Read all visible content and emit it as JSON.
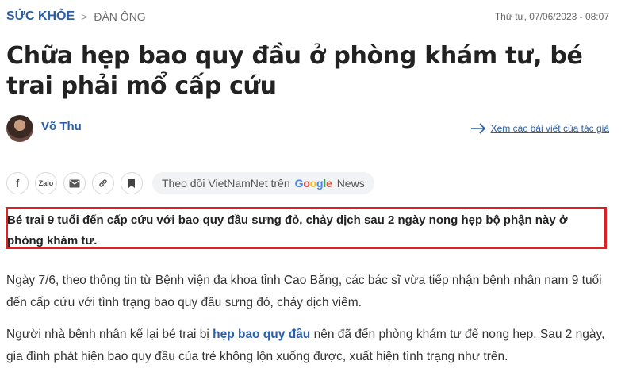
{
  "header": {
    "category": "SỨC KHỎE",
    "breadcrumb_separator": ">",
    "subcategory": "ĐÀN ÔNG",
    "datetime": "Thứ tư, 07/06/2023 - 08:07"
  },
  "article": {
    "title": "Chữa hẹp bao quy đầu ở phòng khám tư, bé trai phải mổ cấp cứu",
    "author": "Võ Thu",
    "author_link": "Xem các bài viết của tác giả",
    "sapo": "Bé trai 9 tuổi đến cấp cứu với bao quy đầu sưng đỏ, chảy dịch sau 2 ngày nong hẹp bộ phận này ở phòng khám tư.",
    "paragraph1": "Ngày 7/6, theo thông tin từ Bệnh viện đa khoa tỉnh Cao Bằng, các bác sĩ vừa tiếp nhận bệnh nhân nam 9 tuổi đến cấp cứu với tình trạng bao quy đầu sưng đỏ, chảy dịch viêm.",
    "paragraph2_before": "Người nhà bệnh nhân kể lại bé trai bị ",
    "paragraph2_link": "hẹp bao quy đầu",
    "paragraph2_after": " nên đã đến phòng khám tư để nong hẹp. Sau 2 ngày, gia đình phát hiện bao quy đầu của trẻ không lộn xuống được, xuất hiện tình trạng như trên."
  },
  "share": {
    "facebook_label": "f",
    "zalo_label": "Zalo",
    "follow_prefix": "Theo dõi VietNamNet trên",
    "google_letters": [
      "G",
      "o",
      "o",
      "g",
      "l",
      "e"
    ],
    "news_word": "News"
  },
  "colors": {
    "accent": "#2a5fa8",
    "highlight_border": "#e02020",
    "text": "#222222"
  },
  "icons": {
    "facebook": "facebook-icon",
    "zalo": "zalo-icon",
    "email": "mail-icon",
    "copy_link": "link-icon",
    "bookmark": "bookmark-icon",
    "arrow": "arrow-right-icon"
  }
}
